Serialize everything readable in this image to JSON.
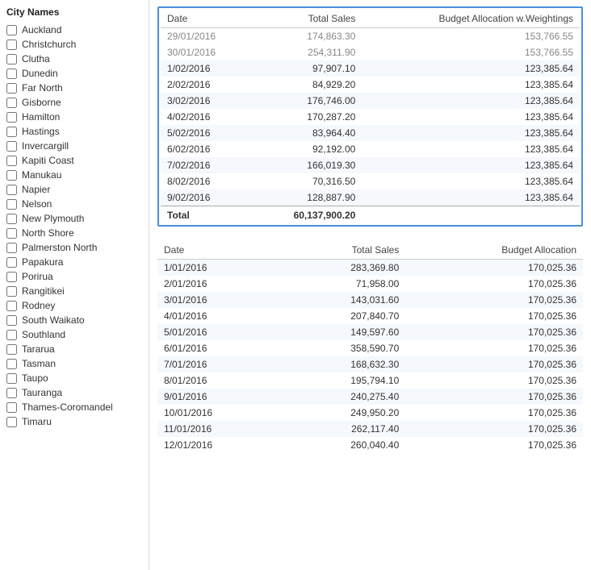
{
  "sidebar": {
    "title": "City Names",
    "cities": [
      {
        "label": "Auckland",
        "checked": false
      },
      {
        "label": "Christchurch",
        "checked": false
      },
      {
        "label": "Clutha",
        "checked": false
      },
      {
        "label": "Dunedin",
        "checked": false
      },
      {
        "label": "Far North",
        "checked": false
      },
      {
        "label": "Gisborne",
        "checked": false
      },
      {
        "label": "Hamilton",
        "checked": false
      },
      {
        "label": "Hastings",
        "checked": false
      },
      {
        "label": "Invercargill",
        "checked": false
      },
      {
        "label": "Kapiti Coast",
        "checked": false
      },
      {
        "label": "Manukau",
        "checked": false
      },
      {
        "label": "Napier",
        "checked": false
      },
      {
        "label": "Nelson",
        "checked": false
      },
      {
        "label": "New Plymouth",
        "checked": false
      },
      {
        "label": "North Shore",
        "checked": false
      },
      {
        "label": "Palmerston North",
        "checked": false
      },
      {
        "label": "Papakura",
        "checked": false
      },
      {
        "label": "Porirua",
        "checked": false
      },
      {
        "label": "Rangitikei",
        "checked": false
      },
      {
        "label": "Rodney",
        "checked": false
      },
      {
        "label": "South Waikato",
        "checked": false
      },
      {
        "label": "Southland",
        "checked": false
      },
      {
        "label": "Tararua",
        "checked": false
      },
      {
        "label": "Tasman",
        "checked": false
      },
      {
        "label": "Taupo",
        "checked": false
      },
      {
        "label": "Tauranga",
        "checked": false
      },
      {
        "label": "Thames-Coromandel",
        "checked": false
      },
      {
        "label": "Timaru",
        "checked": false
      }
    ]
  },
  "table1": {
    "headers": [
      "Date",
      "Total Sales",
      "Budget Allocation w.Weightings"
    ],
    "top_partial": [
      {
        "date": "29/01/2016",
        "sales": "174,863.30",
        "budget": "153,766.55"
      },
      {
        "date": "30/01/2016",
        "sales": "254,311.90",
        "budget": "153,766.55"
      }
    ],
    "rows": [
      {
        "date": "1/02/2016",
        "sales": "97,907.10",
        "budget": "123,385.64"
      },
      {
        "date": "2/02/2016",
        "sales": "84,929.20",
        "budget": "123,385.64"
      },
      {
        "date": "3/02/2016",
        "sales": "176,746.00",
        "budget": "123,385.64"
      },
      {
        "date": "4/02/2016",
        "sales": "170,287.20",
        "budget": "123,385.64"
      },
      {
        "date": "5/02/2016",
        "sales": "83,964.40",
        "budget": "123,385.64"
      },
      {
        "date": "6/02/2016",
        "sales": "92,192.00",
        "budget": "123,385.64"
      },
      {
        "date": "7/02/2016",
        "sales": "166,019.30",
        "budget": "123,385.64"
      },
      {
        "date": "8/02/2016",
        "sales": "70,316.50",
        "budget": "123,385.64"
      },
      {
        "date": "9/02/2016",
        "sales": "128,887.90",
        "budget": "123,385.64"
      }
    ],
    "total_label": "Total",
    "total_sales": "60,137,900.20"
  },
  "table2": {
    "headers": [
      "Date",
      "Total Sales",
      "Budget Allocation"
    ],
    "rows": [
      {
        "date": "1/01/2016",
        "sales": "283,369.80",
        "budget": "170,025.36"
      },
      {
        "date": "2/01/2016",
        "sales": "71,958.00",
        "budget": "170,025.36"
      },
      {
        "date": "3/01/2016",
        "sales": "143,031.60",
        "budget": "170,025.36"
      },
      {
        "date": "4/01/2016",
        "sales": "207,840.70",
        "budget": "170,025.36"
      },
      {
        "date": "5/01/2016",
        "sales": "149,597.60",
        "budget": "170,025.36"
      },
      {
        "date": "6/01/2016",
        "sales": "358,590.70",
        "budget": "170,025.36"
      },
      {
        "date": "7/01/2016",
        "sales": "168,632.30",
        "budget": "170,025.36"
      },
      {
        "date": "8/01/2016",
        "sales": "195,794.10",
        "budget": "170,025.36"
      },
      {
        "date": "9/01/2016",
        "sales": "240,275.40",
        "budget": "170,025.36"
      },
      {
        "date": "10/01/2016",
        "sales": "249,950.20",
        "budget": "170,025.36"
      },
      {
        "date": "11/01/2016",
        "sales": "262,117.40",
        "budget": "170,025.36"
      },
      {
        "date": "12/01/2016",
        "sales": "260,040.40",
        "budget": "170,025.36"
      }
    ]
  }
}
